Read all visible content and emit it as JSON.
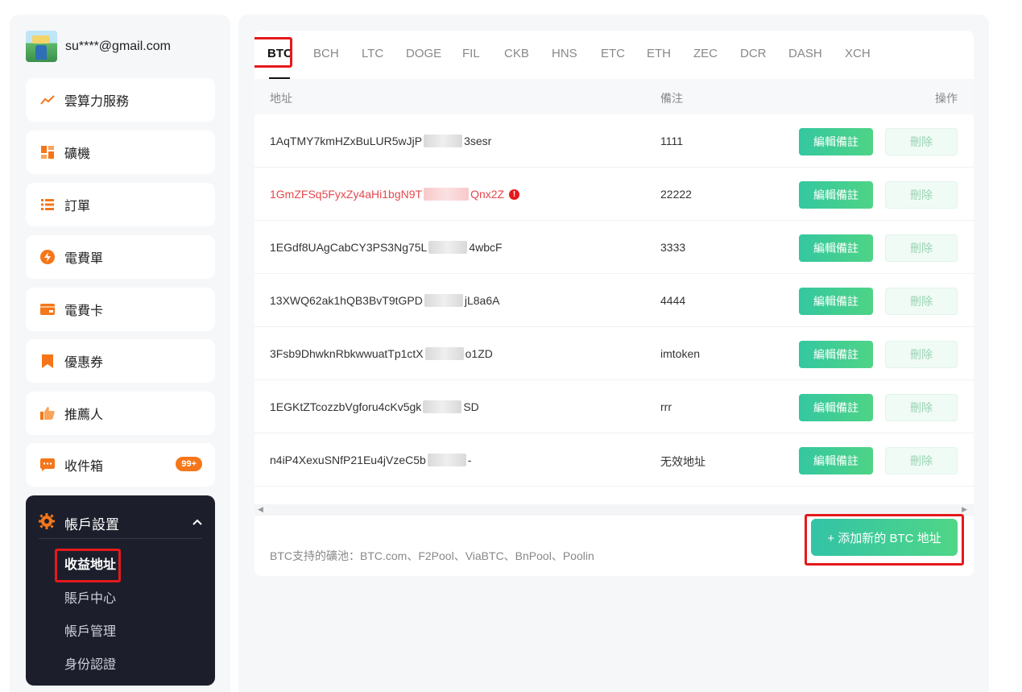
{
  "user": {
    "email": "su****@gmail.com"
  },
  "sidebar": {
    "items": [
      {
        "label": "雲算力服務",
        "icon": "trend-up-icon"
      },
      {
        "label": "礦機",
        "icon": "grid-icon"
      },
      {
        "label": "訂單",
        "icon": "list-icon"
      },
      {
        "label": "電費單",
        "icon": "bolt-icon"
      },
      {
        "label": "電費卡",
        "icon": "card-icon"
      },
      {
        "label": "優惠券",
        "icon": "bookmark-icon"
      },
      {
        "label": "推薦人",
        "icon": "thumbs-up-icon"
      },
      {
        "label": "收件箱",
        "icon": "message-icon",
        "badge": "99+"
      }
    ],
    "account": {
      "label": "帳戶設置",
      "icon": "gear-icon",
      "subitems": [
        "收益地址",
        "賬戶中心",
        "帳戶管理",
        "身份認證"
      ]
    }
  },
  "tabs": [
    "BTC",
    "BCH",
    "LTC",
    "DOGE",
    "FIL",
    "CKB",
    "HNS",
    "ETC",
    "ETH",
    "ZEC",
    "DCR",
    "DASH",
    "XCH"
  ],
  "table": {
    "headers": {
      "address": "地址",
      "note": "備注",
      "actions": "操作"
    },
    "rows": [
      {
        "addr_start": "1AqTMY7kmHZxBuLUR5wJjP",
        "addr_end": "3sesr",
        "note": "1111",
        "invalid": false
      },
      {
        "addr_start": "1GmZFSq5FyxZy4aHi1bgN9T",
        "addr_end": "Qnx2Z",
        "note": "22222",
        "invalid": true
      },
      {
        "addr_start": "1EGdf8UAgCabCY3PS3Ng75L",
        "addr_end": "4wbcF",
        "note": "3333",
        "invalid": false
      },
      {
        "addr_start": "13XWQ62ak1hQB3BvT9tGPD",
        "addr_end": "jL8a6A",
        "note": "4444",
        "invalid": false
      },
      {
        "addr_start": "3Fsb9DhwknRbkwwuatTp1ctX",
        "addr_end": "o1ZD",
        "note": "imtoken",
        "invalid": false
      },
      {
        "addr_start": "1EGKtZTcozzbVgforu4cKv5gk",
        "addr_end": "SD",
        "note": "rrr",
        "invalid": false
      },
      {
        "addr_start": "n4iP4XexuSNfP21Eu4jVzeC5b",
        "addr_end": "-",
        "note": "无效地址",
        "invalid": false
      }
    ],
    "edit_label": "編輯備註",
    "delete_label": "刪除"
  },
  "footer": {
    "supported_pools": "BTC支持的礦池：BTC.com、F2Pool、ViaBTC、BnPool、Poolin",
    "add_button": "+ 添加新的 BTC 地址"
  },
  "colors": {
    "accent_green": "#3ccf95",
    "highlight_red": "#e5191c",
    "sidebar_dark": "#1c1f2b"
  }
}
